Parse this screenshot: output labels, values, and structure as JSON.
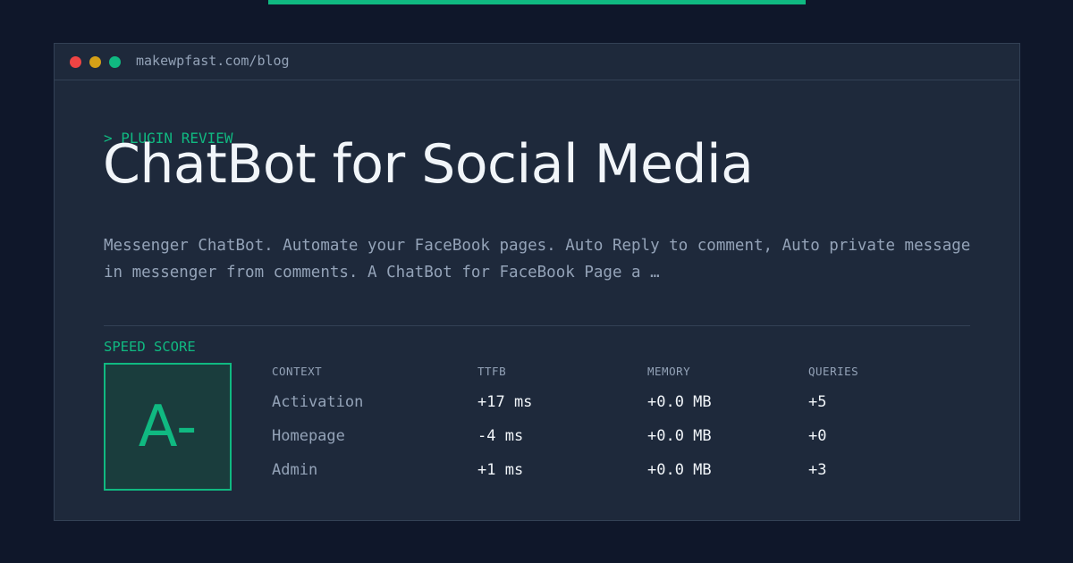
{
  "window": {
    "url": "makewpfast.com/blog"
  },
  "article": {
    "kicker": "> PLUGIN REVIEW",
    "title": "ChatBot for Social Media",
    "description": "Messenger ChatBot. Automate your FaceBook pages. Auto Reply to comment, Auto private message in messenger from comments. A ChatBot for FaceBook Page a …"
  },
  "speed": {
    "label": "SPEED SCORE",
    "grade": "A-",
    "columns": [
      "CONTEXT",
      "TTFB",
      "MEMORY",
      "QUERIES"
    ],
    "rows": [
      {
        "context": "Activation",
        "ttfb": "+17 ms",
        "memory": "+0.0 MB",
        "queries": "+5"
      },
      {
        "context": "Homepage",
        "ttfb": "-4 ms",
        "memory": "+0.0 MB",
        "queries": "+0"
      },
      {
        "context": "Admin",
        "ttfb": "+1 ms",
        "memory": "+0.0 MB",
        "queries": "+3"
      }
    ]
  },
  "colors": {
    "accent": "#10b981",
    "background": "#0f172a",
    "panel": "#1e293b",
    "dot_red": "#ef4444",
    "dot_yellow": "#d4a017",
    "dot_green": "#10b981"
  }
}
